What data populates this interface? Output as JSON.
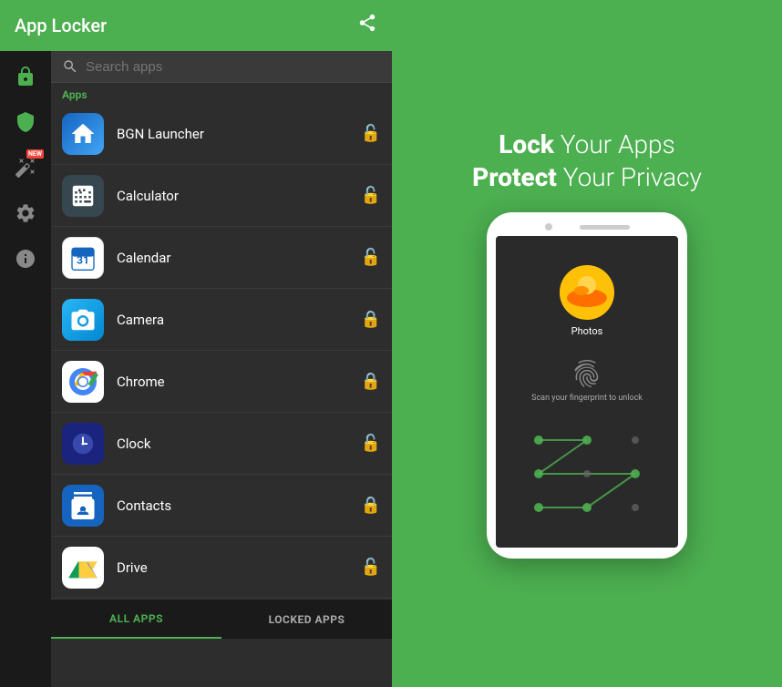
{
  "header": {
    "title": "App Locker",
    "share_label": "share"
  },
  "search": {
    "placeholder": "Search apps"
  },
  "section": {
    "apps_label": "Apps"
  },
  "apps": [
    {
      "name": "BGN Launcher",
      "locked": false,
      "icon": "bgn"
    },
    {
      "name": "Calculator",
      "locked": false,
      "icon": "calc"
    },
    {
      "name": "Calendar",
      "locked": false,
      "icon": "calendar"
    },
    {
      "name": "Camera",
      "locked": true,
      "icon": "camera"
    },
    {
      "name": "Chrome",
      "locked": true,
      "icon": "chrome"
    },
    {
      "name": "Clock",
      "locked": false,
      "icon": "clock"
    },
    {
      "name": "Contacts",
      "locked": true,
      "icon": "contacts"
    },
    {
      "name": "Drive",
      "locked": false,
      "icon": "drive"
    }
  ],
  "tabs": [
    {
      "label": "ALL APPS",
      "active": true
    },
    {
      "label": "LOCKED APPS",
      "active": false
    }
  ],
  "promo": {
    "line1_bold": "Lock",
    "line1_rest": " Your Apps",
    "line2_bold": "Protect",
    "line2_rest": " Your Privacy"
  },
  "phone": {
    "app_name": "Photos",
    "fingerprint_text": "Scan your fingerprint to unlock"
  },
  "sidebar": {
    "icons": [
      {
        "name": "lock-icon",
        "label": "lock"
      },
      {
        "name": "shield-icon",
        "label": "shield"
      },
      {
        "name": "magic-icon",
        "label": "magic",
        "badge": "NEW"
      },
      {
        "name": "settings-icon",
        "label": "settings"
      },
      {
        "name": "info-icon",
        "label": "info"
      }
    ]
  }
}
